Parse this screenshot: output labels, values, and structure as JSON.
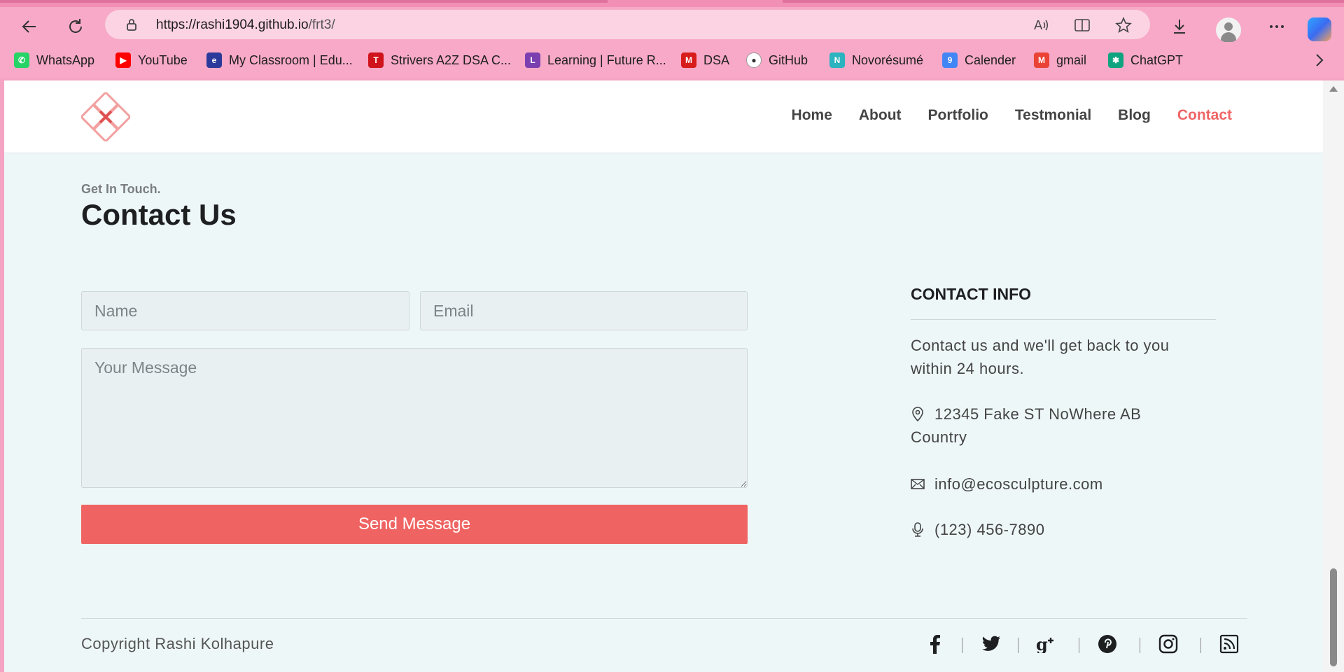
{
  "browser": {
    "url_host": "https://rashi1904.github.io",
    "url_path": "/frt3/",
    "bookmarks": [
      {
        "label": "WhatsApp",
        "icon": "whatsapp-icon",
        "color": "#25d366"
      },
      {
        "label": "YouTube",
        "icon": "youtube-icon",
        "color": "#ff0000"
      },
      {
        "label": "My Classroom | Edu...",
        "icon": "edu-icon",
        "color": "#2b3a9a"
      },
      {
        "label": "Strivers A2Z DSA C...",
        "icon": "tuf-icon",
        "color": "#d0121c"
      },
      {
        "label": "Learning | Future R...",
        "icon": "learning-icon",
        "color": "#7b3fb0"
      },
      {
        "label": "DSA",
        "icon": "dsa-icon",
        "color": "#d81b1b"
      },
      {
        "label": "GitHub",
        "icon": "github-icon",
        "color": "#ffffff"
      },
      {
        "label": "Novorésumé",
        "icon": "novoresume-icon",
        "color": "#2bb3c0"
      },
      {
        "label": "Calender",
        "icon": "calendar-icon",
        "color": "#4285f4"
      },
      {
        "label": "gmail",
        "icon": "gmail-icon",
        "color": "#ea4335"
      },
      {
        "label": "ChatGPT",
        "icon": "chatgpt-icon",
        "color": "#10a37f"
      }
    ]
  },
  "site": {
    "nav": [
      "Home",
      "About",
      "Portfolio",
      "Testmonial",
      "Blog",
      "Contact"
    ],
    "active_nav": "Contact",
    "accent": "#ef6565"
  },
  "contact": {
    "kicker": "Get In Touch.",
    "title": "Contact Us",
    "name_placeholder": "Name",
    "email_placeholder": "Email",
    "message_placeholder": "Your Message",
    "send_label": "Send Message"
  },
  "info": {
    "heading": "CONTACT INFO",
    "blurb": "Contact us and we'll get back to you within 24 hours.",
    "address": "12345 Fake ST NoWhere AB Country",
    "email": "info@ecosculpture.com",
    "phone": "(123) 456-7890"
  },
  "footer": {
    "copyright": "Copyright Rashi Kolhapure",
    "social": [
      "facebook-icon",
      "twitter-icon",
      "google-plus-icon",
      "pinterest-icon",
      "instagram-icon",
      "rss-icon"
    ]
  }
}
